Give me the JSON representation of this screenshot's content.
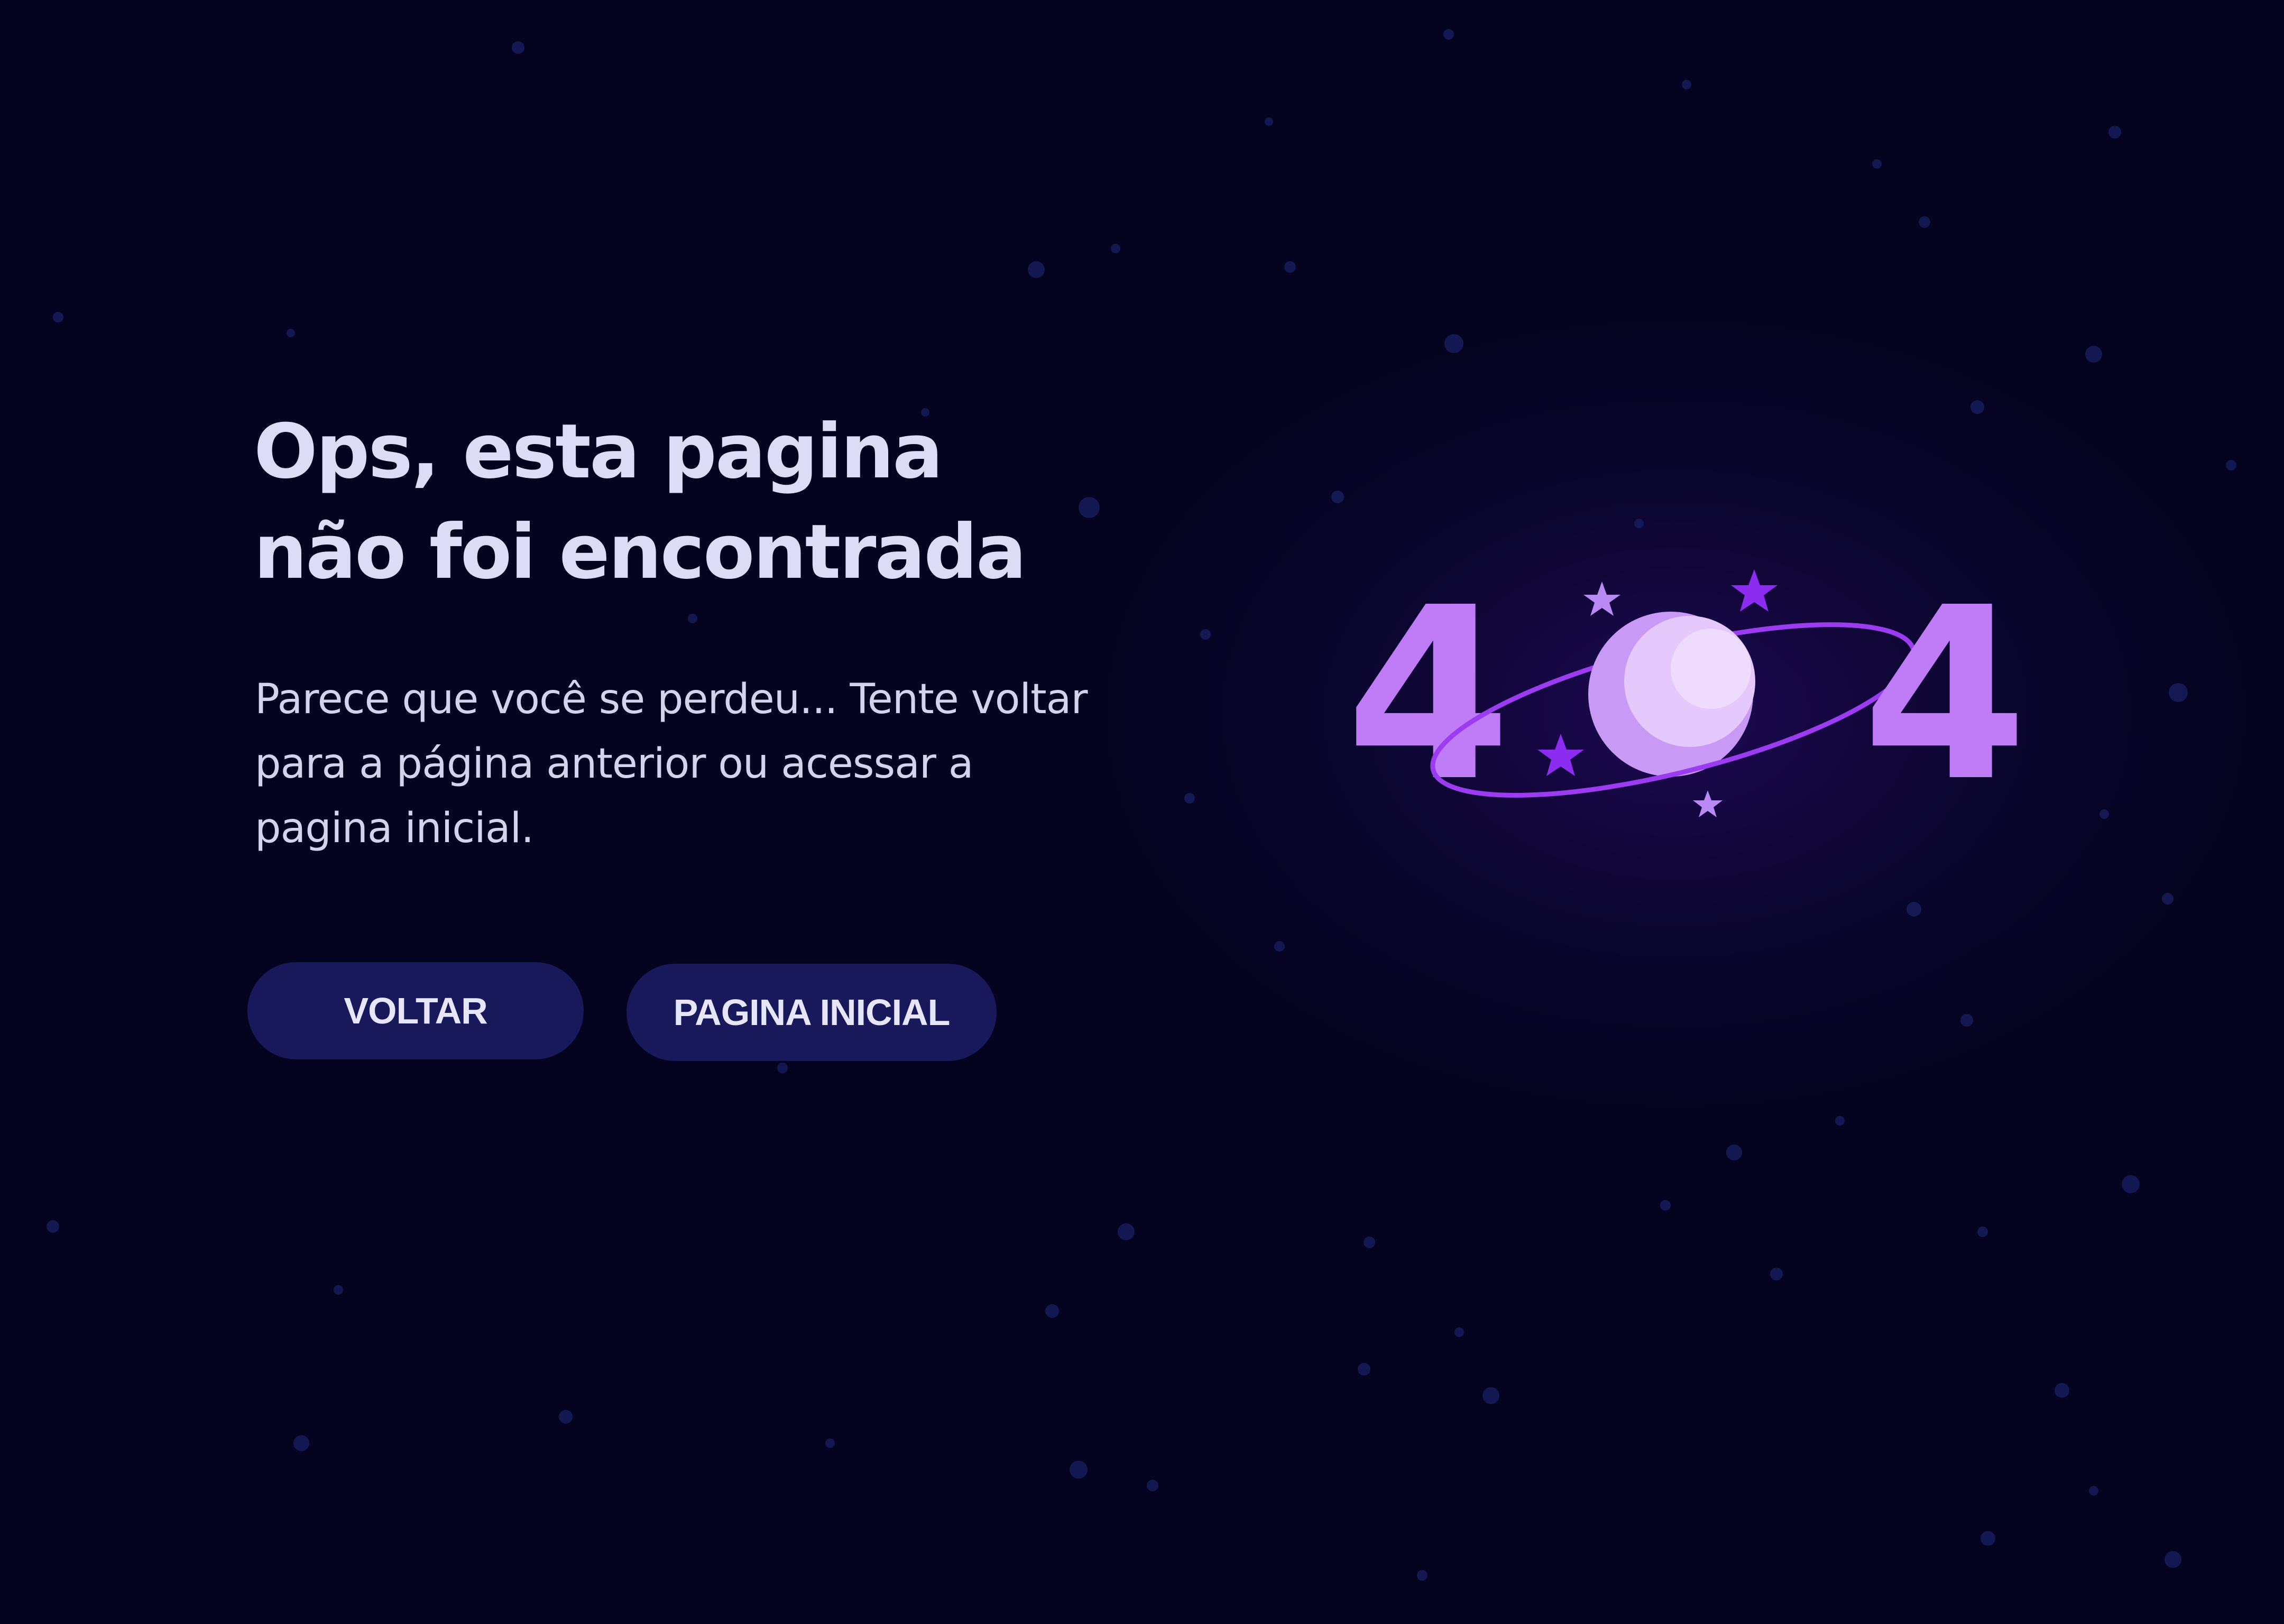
{
  "colors": {
    "background": "#050420",
    "glow": "#1d0a55",
    "heading_text": "#dcdcf6",
    "body_text": "#d3d3ee",
    "button_bg": "#19185a",
    "button_text": "#e6e6fb",
    "digit": "#c07cf7",
    "planet_light": "#e5c8fc",
    "planet_mid": "#c89af6",
    "ring": "#9b3cf0",
    "star_bright": "#8b2cf0",
    "star_light": "#b98af6"
  },
  "heading": {
    "line1": "Ops, esta pagina",
    "line2": "não foi encontrada"
  },
  "description": {
    "line1": "Parece que você se perdeu... Tente voltar",
    "line2": "para a página anterior ou acessar a",
    "line3": "pagina inicial."
  },
  "buttons": {
    "back_label": "VOLTAR",
    "home_label": "PAGINA INICIAL"
  },
  "illustration": {
    "digit_left": "4",
    "digit_right": "4",
    "planet_icon": "ringed-planet-icon",
    "star_icon": "star-icon"
  }
}
